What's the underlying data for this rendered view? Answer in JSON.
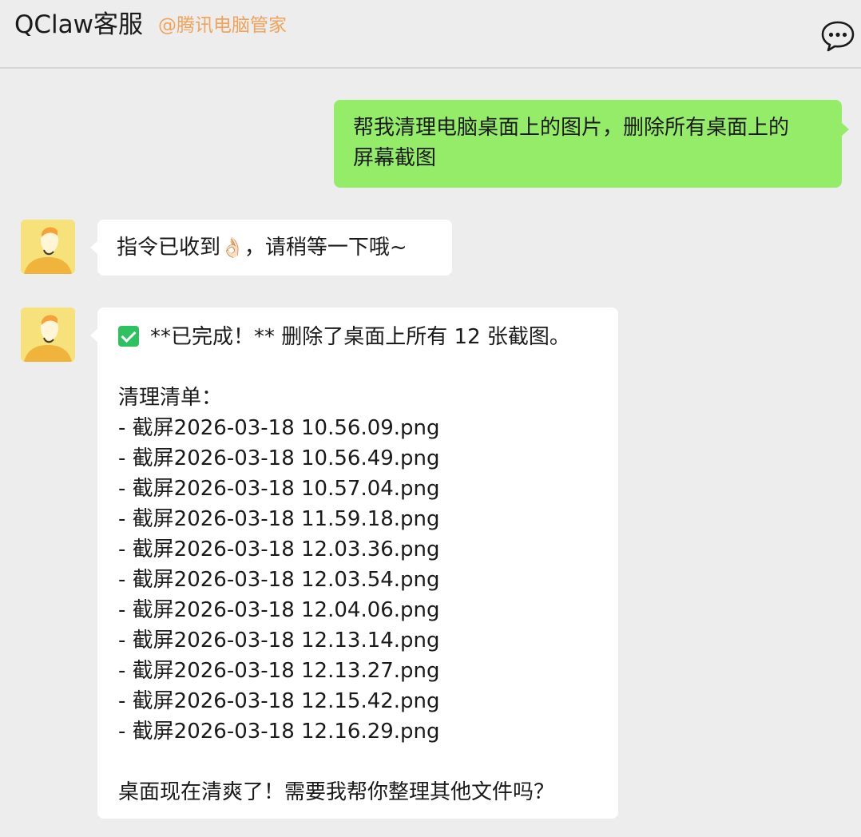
{
  "header": {
    "title": "QClaw客服",
    "subtitle": "@腾讯电脑管家",
    "more_icon": "chat-bubble-ellipsis-icon"
  },
  "messages": [
    {
      "sender": "me",
      "lines": [
        "帮我清理电脑桌面上的图片，删除所有桌面上的",
        "屏幕截图"
      ]
    },
    {
      "sender": "bot",
      "text_before": "指令已收到",
      "emoji": "👌🏻",
      "text_after": "，请稍等一下哦~"
    },
    {
      "sender": "bot",
      "status_icon": "green-check-icon",
      "status_text": "**已完成！** 删除了桌面上所有 12 张截图。",
      "list_title": "清理清单：",
      "files": [
        "- 截屏2026-03-18 10.56.09.png",
        "- 截屏2026-03-18 10.56.49.png",
        "- 截屏2026-03-18 10.57.04.png",
        "- 截屏2026-03-18 11.59.18.png",
        "- 截屏2026-03-18 12.03.36.png",
        "- 截屏2026-03-18 12.03.54.png",
        "- 截屏2026-03-18 12.04.06.png",
        "- 截屏2026-03-18 12.13.14.png",
        "- 截屏2026-03-18 12.13.27.png",
        "- 截屏2026-03-18 12.15.42.png",
        "- 截屏2026-03-18 12.16.29.png"
      ],
      "closing": "桌面现在清爽了！需要我帮你整理其他文件吗？"
    }
  ],
  "colors": {
    "background": "#ededed",
    "my_bubble": "#95ec69",
    "bot_bubble": "#ffffff",
    "subtitle": "#f0a35a",
    "check": "#2fc15f"
  }
}
